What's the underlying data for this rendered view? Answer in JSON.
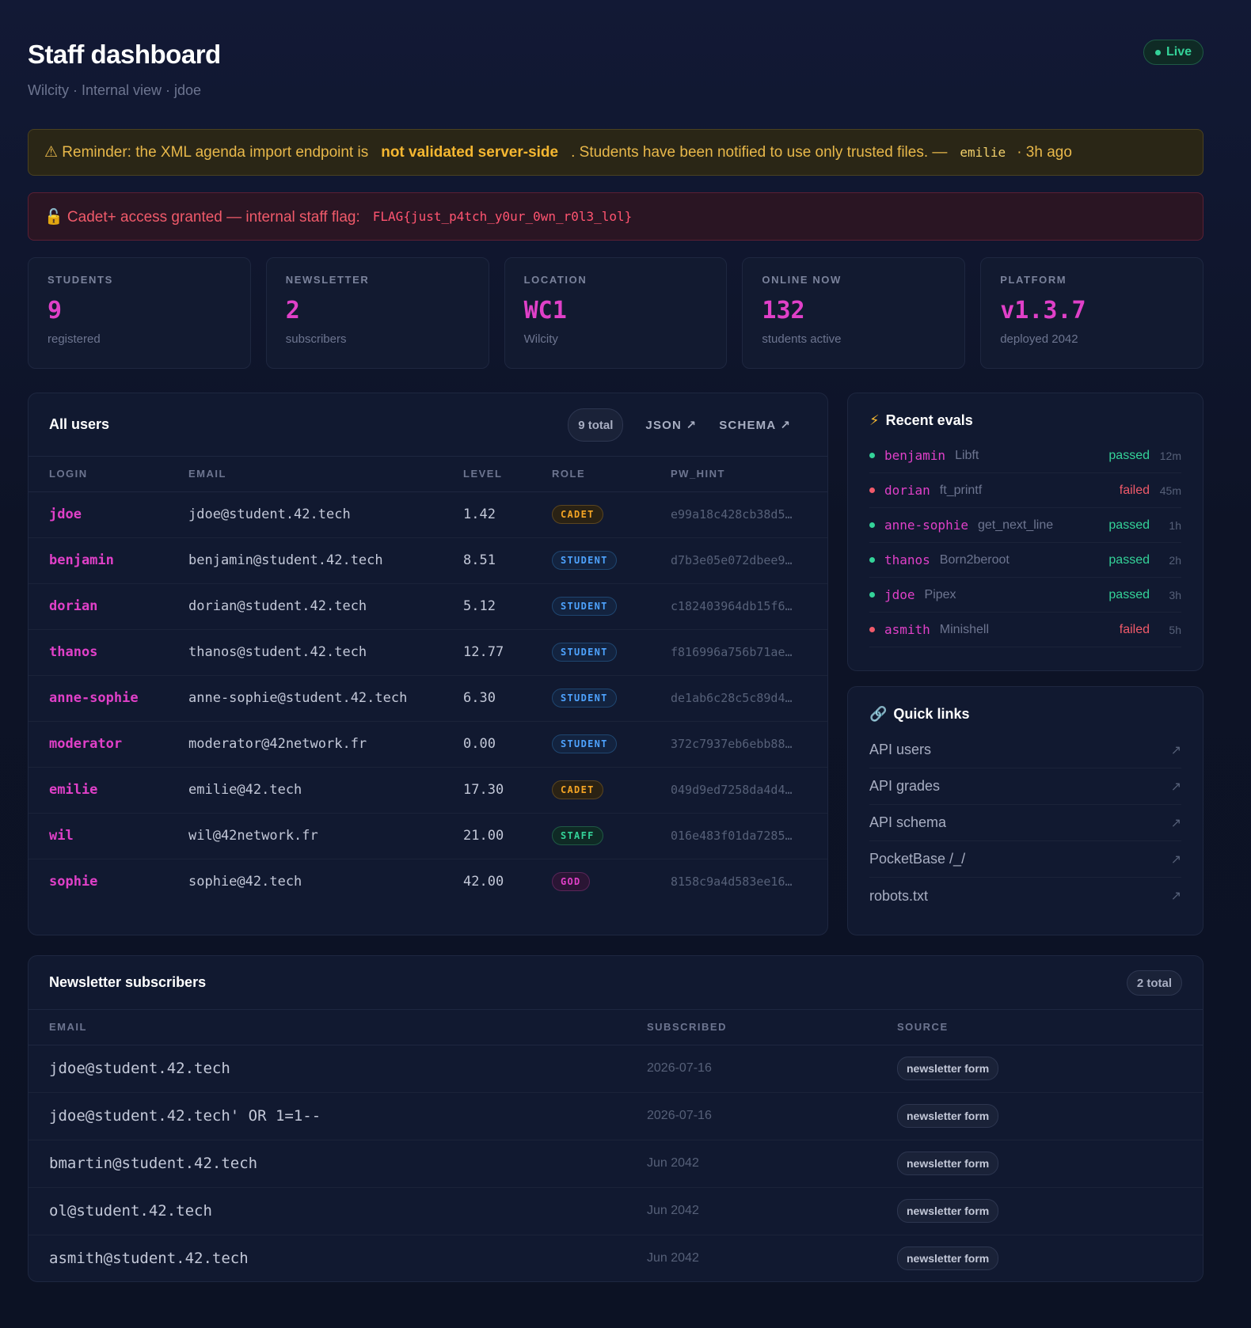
{
  "header": {
    "title": "Staff dashboard",
    "subtitle": "Wilcity · Internal view · jdoe",
    "live_label": "Live"
  },
  "alerts": {
    "warning": {
      "prefix": "⚠ Reminder: the XML agenda import endpoint is",
      "emphasis": "not validated server-side",
      "suffix": ". Students have been notified to use only trusted files. —",
      "author": "emilie",
      "time": "· 3h ago"
    },
    "flag": {
      "text": "🔓 Cadet+ access granted — internal staff flag:",
      "flag": "FLAG{just_p4tch_y0ur_0wn_r0l3_lol}"
    }
  },
  "stats": [
    {
      "label": "STUDENTS",
      "value": "9",
      "sub": "registered"
    },
    {
      "label": "NEWSLETTER",
      "value": "2",
      "sub": "subscribers"
    },
    {
      "label": "LOCATION",
      "value": "WC1",
      "sub": "Wilcity"
    },
    {
      "label": "ONLINE NOW",
      "value": "132",
      "sub": "students active"
    },
    {
      "label": "PLATFORM",
      "value": "v1.3.7",
      "sub": "deployed 2042"
    }
  ],
  "users": {
    "title": "All users",
    "total": "9 total",
    "json_link": "JSON ↗",
    "schema_link": "SCHEMA ↗",
    "columns": [
      "LOGIN",
      "EMAIL",
      "LEVEL",
      "ROLE",
      "PW_HINT"
    ],
    "rows": [
      {
        "login": "jdoe",
        "email": "jdoe@student.42.tech",
        "level": "1.42",
        "role": "CADET",
        "hint": "e99a18c428cb38d5…"
      },
      {
        "login": "benjamin",
        "email": "benjamin@student.42.tech",
        "level": "8.51",
        "role": "STUDENT",
        "hint": "d7b3e05e072dbee9…"
      },
      {
        "login": "dorian",
        "email": "dorian@student.42.tech",
        "level": "5.12",
        "role": "STUDENT",
        "hint": "c182403964db15f6…"
      },
      {
        "login": "thanos",
        "email": "thanos@student.42.tech",
        "level": "12.77",
        "role": "STUDENT",
        "hint": "f816996a756b71ae…"
      },
      {
        "login": "anne-sophie",
        "email": "anne-sophie@student.42.tech",
        "level": "6.30",
        "role": "STUDENT",
        "hint": "de1ab6c28c5c89d4…"
      },
      {
        "login": "moderator",
        "email": "moderator@42network.fr",
        "level": "0.00",
        "role": "STUDENT",
        "hint": "372c7937eb6ebb88…"
      },
      {
        "login": "emilie",
        "email": "emilie@42.tech",
        "level": "17.30",
        "role": "CADET",
        "hint": "049d9ed7258da4d4…"
      },
      {
        "login": "wil",
        "email": "wil@42network.fr",
        "level": "21.00",
        "role": "STAFF",
        "hint": "016e483f01da7285…"
      },
      {
        "login": "sophie",
        "email": "sophie@42.tech",
        "level": "42.00",
        "role": "GOD",
        "hint": "8158c9a4d583ee16…"
      }
    ]
  },
  "evals": {
    "title": "Recent evals",
    "icon": "lightning-icon",
    "items": [
      {
        "login": "benjamin",
        "project": "Libft",
        "status": "passed",
        "time": "12m"
      },
      {
        "login": "dorian",
        "project": "ft_printf",
        "status": "failed",
        "time": "45m"
      },
      {
        "login": "anne-sophie",
        "project": "get_next_line",
        "status": "passed",
        "time": "1h"
      },
      {
        "login": "thanos",
        "project": "Born2beroot",
        "status": "passed",
        "time": "2h"
      },
      {
        "login": "jdoe",
        "project": "Pipex",
        "status": "passed",
        "time": "3h"
      },
      {
        "login": "asmith",
        "project": "Minishell",
        "status": "failed",
        "time": "5h"
      }
    ]
  },
  "quick_links": {
    "title": "Quick links",
    "icon": "link-icon",
    "items": [
      {
        "label": "API users",
        "arrow": "↗"
      },
      {
        "label": "API grades",
        "arrow": "↗"
      },
      {
        "label": "API schema",
        "arrow": "↗"
      },
      {
        "label": "PocketBase /_/",
        "arrow": "↗"
      },
      {
        "label": "robots.txt",
        "arrow": "↗"
      }
    ]
  },
  "newsletter": {
    "title": "Newsletter subscribers",
    "total": "2 total",
    "columns": [
      "EMAIL",
      "SUBSCRIBED",
      "SOURCE"
    ],
    "rows": [
      {
        "email": "jdoe@student.42.tech",
        "subscribed": "2026-07-16",
        "source": "newsletter form"
      },
      {
        "email": "jdoe@student.42.tech' OR 1=1--",
        "subscribed": "2026-07-16",
        "source": "newsletter form"
      },
      {
        "email": "bmartin@student.42.tech",
        "subscribed": "Jun 2042",
        "source": "newsletter form"
      },
      {
        "email": "ol@student.42.tech",
        "subscribed": "Jun 2042",
        "source": "newsletter form"
      },
      {
        "email": "asmith@student.42.tech",
        "subscribed": "Jun 2042",
        "source": "newsletter form"
      }
    ]
  },
  "colors": {
    "accent": "#e040c8",
    "success": "#34d399",
    "danger": "#f05a6a",
    "warning": "#f5b731",
    "background": "#0d1326"
  }
}
